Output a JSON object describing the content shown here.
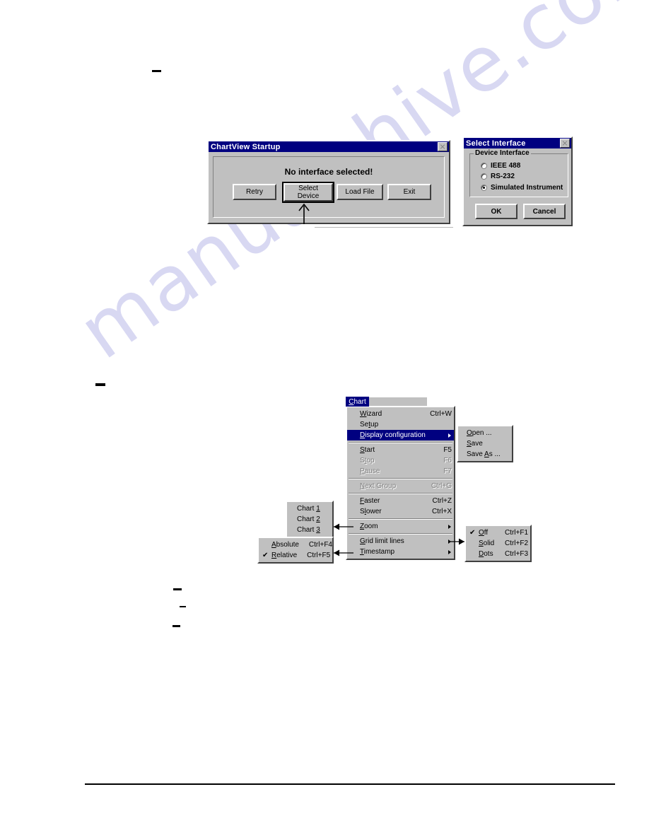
{
  "page": {
    "watermark": "manualshive.com"
  },
  "startup_dialog": {
    "title": "ChartView Startup",
    "close_icon": "close-icon",
    "message": "No interface selected!",
    "buttons": [
      {
        "label": "Retry",
        "default": false
      },
      {
        "label": "Select\nDevice",
        "default": true
      },
      {
        "label": "Load File",
        "default": false
      },
      {
        "label": "Exit",
        "default": false
      }
    ],
    "callout_arrow": "up-arrow-pointing-to-select-device"
  },
  "select_interface_dialog": {
    "title": "Select Interface",
    "close_icon": "close-icon",
    "group_label": "Device Interface",
    "options": [
      {
        "label": "IEEE 488",
        "selected": false
      },
      {
        "label": "RS-232",
        "selected": false
      },
      {
        "label": "Simulated Instrument",
        "selected": true
      }
    ],
    "buttons": [
      {
        "label": "OK"
      },
      {
        "label": "Cancel"
      }
    ]
  },
  "chart_menu": {
    "title": "Chart",
    "title_mnemonic": "C",
    "items": [
      {
        "label": "Wizard",
        "mnemonic": "W",
        "accel": "Ctrl+W",
        "state": "enabled",
        "submenu": false
      },
      {
        "label": "Setup",
        "mnemonic": "t",
        "accel": "",
        "state": "enabled",
        "submenu": false
      },
      {
        "label": "Display configuration",
        "mnemonic": "D",
        "accel": "",
        "state": "highlighted",
        "submenu": true
      },
      {
        "separator": true
      },
      {
        "label": "Start",
        "mnemonic": "S",
        "accel": "F5",
        "state": "enabled",
        "submenu": false
      },
      {
        "label": "Stop",
        "mnemonic": "t",
        "accel": "F6",
        "state": "disabled",
        "submenu": false
      },
      {
        "label": "Pause",
        "mnemonic": "P",
        "accel": "F7",
        "state": "disabled",
        "submenu": false
      },
      {
        "separator": true
      },
      {
        "label": "Next Group",
        "mnemonic": "N",
        "accel": "Ctrl+G",
        "state": "disabled",
        "submenu": false
      },
      {
        "separator": true
      },
      {
        "label": "Faster",
        "mnemonic": "F",
        "accel": "Ctrl+Z",
        "state": "enabled",
        "submenu": false
      },
      {
        "label": "Slower",
        "mnemonic": "l",
        "accel": "Ctrl+X",
        "state": "enabled",
        "submenu": false
      },
      {
        "separator": true
      },
      {
        "label": "Zoom",
        "mnemonic": "Z",
        "accel": "",
        "state": "enabled",
        "submenu": true
      },
      {
        "separator": true
      },
      {
        "label": "Grid limit lines",
        "mnemonic": "G",
        "accel": "",
        "state": "enabled",
        "submenu": true
      },
      {
        "label": "Timestamp",
        "mnemonic": "T",
        "accel": "",
        "state": "enabled",
        "submenu": true
      }
    ]
  },
  "display_configuration_submenu": {
    "items": [
      {
        "label": "Open ...",
        "mnemonic": "O"
      },
      {
        "label": "Save",
        "mnemonic": "S"
      },
      {
        "label": "Save As ...",
        "mnemonic": "A"
      }
    ]
  },
  "zoom_submenu": {
    "items": [
      {
        "label": "Chart 1",
        "mnemonic": "1"
      },
      {
        "label": "Chart 2",
        "mnemonic": "2"
      },
      {
        "label": "Chart 3",
        "mnemonic": "3"
      }
    ]
  },
  "grid_limit_lines_submenu": {
    "items": [
      {
        "label": "Off",
        "mnemonic": "O",
        "accel": "Ctrl+F1",
        "checked": true
      },
      {
        "label": "Solid",
        "mnemonic": "S",
        "accel": "Ctrl+F2",
        "checked": false
      },
      {
        "label": "Dots",
        "mnemonic": "D",
        "accel": "Ctrl+F3",
        "checked": false
      }
    ]
  },
  "timestamp_submenu": {
    "items": [
      {
        "label": "Absolute",
        "mnemonic": "A",
        "accel": "Ctrl+F4",
        "checked": false
      },
      {
        "label": "Relative",
        "mnemonic": "R",
        "accel": "Ctrl+F5",
        "checked": true
      }
    ]
  }
}
